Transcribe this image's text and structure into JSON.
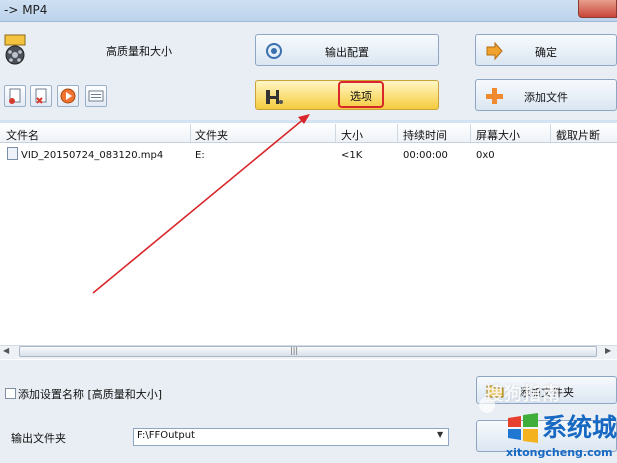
{
  "window": {
    "title": "-> MP4"
  },
  "top": {
    "quality_label": "高质量和大小",
    "output_config_label": "输出配置",
    "ok_label": "确定",
    "options_label": "选项",
    "add_file_label": "添加文件"
  },
  "toolbar": {
    "icons": [
      "clear-list-icon",
      "remove-item-icon",
      "play-icon",
      "info-icon"
    ]
  },
  "table": {
    "columns": [
      "文件名",
      "文件夹",
      "大小",
      "持续时间",
      "屏幕大小",
      "截取片断"
    ],
    "rows": [
      [
        "VID_20150724_083120.mp4",
        "E:",
        "<1K",
        "00:00:00",
        "0x0",
        ""
      ]
    ]
  },
  "bottom": {
    "add_setting_name_label": "添加设置名称 [高质量和大小]",
    "add_folder_label": "添加文件夹",
    "output_folder_label": "输出文件夹",
    "output_path_value": "F:\\FFOutput"
  },
  "watermark": {
    "sogou": "搜狗指南",
    "site_name": "系统城",
    "site_url": "xitongcheng.com"
  },
  "colors": {
    "highlight_box": "#d8262a",
    "annotation_arrow": "#d8262a",
    "options_button": "#f5cc3e"
  }
}
